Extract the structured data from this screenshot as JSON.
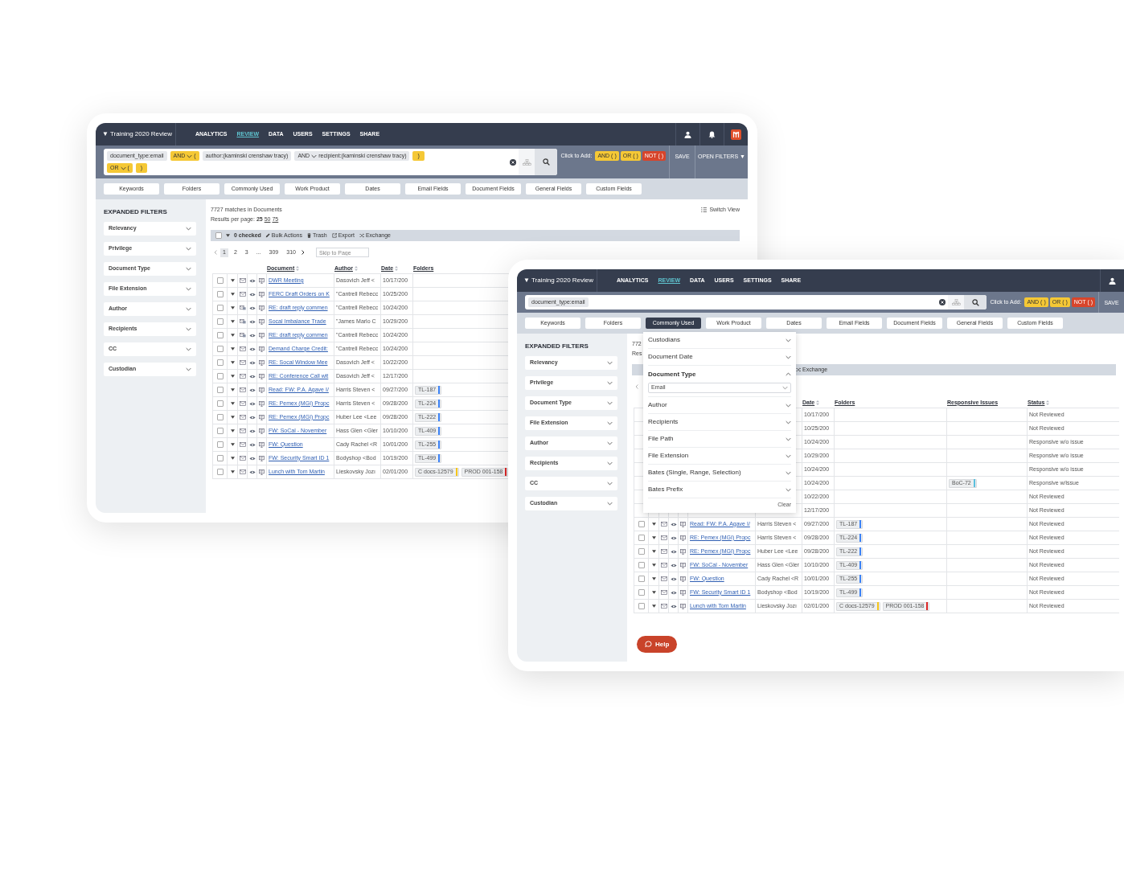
{
  "back_window": {
    "title": "▼ Training 2020 Review",
    "nav": [
      {
        "label": "ANALYTICS",
        "selected": false
      },
      {
        "label": "REVIEW",
        "selected": true
      },
      {
        "label": "DATA",
        "selected": false
      },
      {
        "label": "USERS",
        "selected": false
      },
      {
        "label": "SETTINGS",
        "selected": false
      },
      {
        "label": "SHARE",
        "selected": false
      }
    ],
    "header_buttons": [
      {
        "kind": "user"
      },
      {
        "kind": "bell"
      },
      {
        "kind": "logo"
      }
    ],
    "search": {
      "lines": [
        [
          {
            "kind": "term",
            "label": "document_type:email"
          },
          {
            "kind": "operator",
            "label": "AND",
            "suffix": "("
          },
          {
            "kind": "term",
            "label": "author:(kaminski crenshaw tracy)"
          },
          {
            "kind": "operator_term",
            "label": "AND",
            "suffix": "recipient:(kaminski crenshaw tracy)"
          },
          {
            "kind": "close",
            "label": ")"
          }
        ],
        [
          {
            "kind": "operator",
            "label": "OR",
            "suffix": "("
          },
          {
            "kind": "close",
            "label": ")"
          }
        ]
      ]
    },
    "click_to_add": {
      "label": "Click to Add:",
      "chips": [
        {
          "kind": "and",
          "label": "AND ( )"
        },
        {
          "kind": "or",
          "label": "OR ( )"
        },
        {
          "kind": "not",
          "label": "NOT ( )"
        }
      ]
    },
    "save": "SAVE",
    "open_filters": "OPEN FILTERS ▼",
    "filter_tabs": [
      {
        "label": "Keywords",
        "selected": false
      },
      {
        "label": "Folders",
        "selected": false
      },
      {
        "label": "Commonly Used",
        "selected": false
      },
      {
        "label": "Work Product",
        "selected": false
      },
      {
        "label": "Dates",
        "selected": false
      },
      {
        "label": "Email Fields",
        "selected": false
      },
      {
        "label": "Document Fields",
        "selected": false
      },
      {
        "label": "General Fields",
        "selected": false
      },
      {
        "label": "Custom Fields",
        "selected": false
      }
    ],
    "sidebar": {
      "heading": "EXPANDED FILTERS",
      "filters": [
        "Relevancy",
        "Privilege",
        "Document Type",
        "File Extension",
        "Author",
        "Recipients",
        "CC",
        "Custodian"
      ]
    },
    "results": {
      "matches": "7727 matches in Documents",
      "per_page_label": "Results per page:",
      "per_page": [
        {
          "label": "25",
          "selected": true
        },
        {
          "label": "50",
          "selected": false
        },
        {
          "label": "75",
          "selected": false
        }
      ]
    },
    "switch_view": "Switch View",
    "bulk": {
      "all_checked": false,
      "checked": "0 checked",
      "actions": [
        {
          "kind": "edit",
          "label": "Bulk Actions"
        },
        {
          "kind": "trash",
          "label": "Trash"
        },
        {
          "kind": "export",
          "label": "Export"
        },
        {
          "kind": "exchange",
          "label": "Exchange"
        }
      ]
    },
    "pagination": {
      "pages": [
        {
          "label": "1",
          "selected": true
        },
        {
          "label": "2",
          "selected": false
        },
        {
          "label": "3",
          "selected": false
        },
        {
          "label": "...",
          "selected": false
        },
        {
          "label": "309",
          "selected": false
        },
        {
          "label": "310",
          "selected": false
        }
      ],
      "skip_placeholder": "Skip to Page"
    },
    "table": {
      "columns": [
        {
          "kind": "document",
          "label": "Document",
          "sortable": true
        },
        {
          "kind": "author",
          "label": "Author",
          "sortable": true
        },
        {
          "kind": "date",
          "label": "Date",
          "sortable": true
        },
        {
          "kind": "folders",
          "label": "Folders",
          "sortable": false
        }
      ],
      "rows": [
        {
          "kind": "email",
          "checked": false,
          "document": "DWR Meeting",
          "author": "Dasovich Jeff <",
          "date": "10/17/200",
          "folders": []
        },
        {
          "kind": "email",
          "checked": false,
          "document": "FERC Draft Orders on K",
          "author": "\"Cantrell Rebecc",
          "date": "10/25/200",
          "folders": []
        },
        {
          "kind": "email_attachment",
          "checked": false,
          "document": "RE: draft reply commen",
          "author": "\"Cantrell Rebecc",
          "date": "10/24/200",
          "folders": []
        },
        {
          "kind": "email_attachment",
          "checked": false,
          "document": "Socal Imbalance Trade",
          "author": "\"James Marlo C",
          "date": "10/29/200",
          "folders": []
        },
        {
          "kind": "email_attachment",
          "checked": false,
          "document": "RE: draft reply commen",
          "author": "\"Cantrell Rebecc",
          "date": "10/24/200",
          "folders": []
        },
        {
          "kind": "email",
          "checked": false,
          "document": "Demand Charge Credit:",
          "author": "\"Cantrell Rebecc",
          "date": "10/24/200",
          "folders": []
        },
        {
          "kind": "email",
          "checked": false,
          "document": "RE: Socal Window Mee",
          "author": "Dasovich Jeff <",
          "date": "10/22/200",
          "folders": []
        },
        {
          "kind": "email",
          "checked": false,
          "document": "RE: Conference Call wit",
          "author": "Dasovich Jeff <",
          "date": "12/17/200",
          "folders": []
        },
        {
          "kind": "email",
          "checked": false,
          "document": "Read: FW: P.A. Agave I/",
          "author": "Harris Steven <",
          "date": "09/27/200",
          "folders": [
            {
              "label": "TL-187",
              "color": "#3b82f6"
            }
          ]
        },
        {
          "kind": "email",
          "checked": false,
          "document": "RE: Pemex (MGI) Propc",
          "author": "Harris Steven <",
          "date": "09/28/200",
          "folders": [
            {
              "label": "TL-224",
              "color": "#3b82f6"
            }
          ]
        },
        {
          "kind": "email",
          "checked": false,
          "document": "RE: Pemex (MGI) Propc",
          "author": "Huber Lee <Lee",
          "date": "09/28/200",
          "folders": [
            {
              "label": "TL-222",
              "color": "#3b82f6"
            }
          ]
        },
        {
          "kind": "email",
          "checked": false,
          "document": "FW: SoCal - November",
          "author": "Hass Glen <Gler",
          "date": "10/10/200",
          "folders": [
            {
              "label": "TL-409",
              "color": "#3b82f6"
            }
          ]
        },
        {
          "kind": "email",
          "checked": false,
          "document": "FW: Question",
          "author": "Cady Rachel <R",
          "date": "10/01/200",
          "folders": [
            {
              "label": "TL-255",
              "color": "#3b82f6"
            }
          ]
        },
        {
          "kind": "email",
          "checked": false,
          "document": "FW: Security Smart ID 1",
          "author": "Bodyshop <Bod",
          "date": "10/19/200",
          "folders": [
            {
              "label": "TL-499",
              "color": "#3b82f6"
            }
          ]
        },
        {
          "kind": "email",
          "checked": false,
          "document": "Lunch with Tom Martin",
          "author": "Lieskovsky Jozı",
          "date": "02/01/200",
          "folders": [
            {
              "label": "C docs-12579",
              "color": "#f5c518"
            },
            {
              "label": "PROD 001-158",
              "color": "#dc2626"
            }
          ]
        }
      ]
    }
  },
  "front_window": {
    "title": "▼ Training 2020 Review",
    "nav": [
      {
        "label": "ANALYTICS",
        "selected": false
      },
      {
        "label": "REVIEW",
        "selected": true
      },
      {
        "label": "DATA",
        "selected": false
      },
      {
        "label": "USERS",
        "selected": false
      },
      {
        "label": "SETTINGS",
        "selected": false
      },
      {
        "label": "SHARE",
        "selected": false
      }
    ],
    "header_buttons": [
      {
        "kind": "user"
      }
    ],
    "search": {
      "lines": [
        [
          {
            "kind": "term",
            "label": "document_type:email"
          }
        ]
      ]
    },
    "click_to_add": {
      "label": "Click to Add:",
      "chips": [
        {
          "kind": "and",
          "label": "AND ( )"
        },
        {
          "kind": "or",
          "label": "OR ( )"
        },
        {
          "kind": "not",
          "label": "NOT ( )"
        }
      ]
    },
    "save": "SAVE",
    "filter_tabs": [
      {
        "label": "Keywords",
        "selected": false
      },
      {
        "label": "Folders",
        "selected": false
      },
      {
        "label": "Commonly Used",
        "selected": true
      },
      {
        "label": "Work Product",
        "selected": false
      },
      {
        "label": "Dates",
        "selected": false
      },
      {
        "label": "Email Fields",
        "selected": false
      },
      {
        "label": "Document Fields",
        "selected": false
      },
      {
        "label": "General Fields",
        "selected": false
      },
      {
        "label": "Custom Fields",
        "selected": false
      }
    ],
    "sidebar": {
      "heading": "EXPANDED FILTERS",
      "filters": [
        "Relevancy",
        "Privilege",
        "Document Type",
        "File Extension",
        "Author",
        "Recipients",
        "CC",
        "Custodian"
      ]
    },
    "results": {
      "matches": "772",
      "per_page_label": "Res"
    },
    "bulk": {
      "actions": [
        {
          "kind": "exchange",
          "label": "Exchange"
        }
      ]
    },
    "table": {
      "columns": [
        {
          "kind": "date",
          "label": "Date",
          "sortable": true
        },
        {
          "kind": "folders",
          "label": "Folders",
          "sortable": false
        },
        {
          "kind": "issues",
          "label": "Responsive Issues",
          "sortable": false
        },
        {
          "kind": "status",
          "label": "Status",
          "sortable": true
        }
      ],
      "rows": [
        {
          "date": "10/17/200",
          "folders": [],
          "issues": [],
          "status": "Not Reviewed"
        },
        {
          "date": "10/25/200",
          "folders": [],
          "issues": [],
          "status": "Not Reviewed"
        },
        {
          "date": "10/24/200",
          "folders": [],
          "issues": [],
          "status": "Responsive w/o issue"
        },
        {
          "date": "10/29/200",
          "folders": [],
          "issues": [],
          "status": "Responsive w/o issue"
        },
        {
          "date": "10/24/200",
          "folders": [],
          "issues": [],
          "status": "Responsive w/o issue"
        },
        {
          "date": "10/24/200",
          "folders": [],
          "issues": [
            {
              "label": "BoC-72",
              "color": "#5bc0de"
            }
          ],
          "status": "Responsive w/issue"
        },
        {
          "date": "10/22/200",
          "folders": [],
          "issues": [],
          "status": "Not Reviewed"
        },
        {
          "date": "12/17/200",
          "folders": [],
          "issues": [],
          "status": "Not Reviewed"
        },
        {
          "kind": "email",
          "checked": false,
          "document": "Read: FW: P.A. Agave I/",
          "author": "Harris Steven <",
          "date": "09/27/200",
          "folders": [
            {
              "label": "TL-187",
              "color": "#3b82f6"
            }
          ],
          "issues": [],
          "status": "Not Reviewed"
        },
        {
          "kind": "email",
          "checked": false,
          "document": "RE: Pemex (MGI) Propc",
          "author": "Harris Steven <",
          "date": "09/28/200",
          "folders": [
            {
              "label": "TL-224",
              "color": "#3b82f6"
            }
          ],
          "issues": [],
          "status": "Not Reviewed"
        },
        {
          "kind": "email",
          "checked": false,
          "document": "RE: Pemex (MGI) Propc",
          "author": "Huber Lee <Lee",
          "date": "09/28/200",
          "folders": [
            {
              "label": "TL-222",
              "color": "#3b82f6"
            }
          ],
          "issues": [],
          "status": "Not Reviewed"
        },
        {
          "kind": "email",
          "checked": false,
          "document": "FW: SoCal - November",
          "author": "Hass Glen <Gler",
          "date": "10/10/200",
          "folders": [
            {
              "label": "TL-409",
              "color": "#3b82f6"
            }
          ],
          "issues": [],
          "status": "Not Reviewed"
        },
        {
          "kind": "email",
          "checked": false,
          "document": "FW: Question",
          "author": "Cady Rachel <R",
          "date": "10/01/200",
          "folders": [
            {
              "label": "TL-255",
              "color": "#3b82f6"
            }
          ],
          "issues": [],
          "status": "Not Reviewed"
        },
        {
          "kind": "email",
          "checked": false,
          "document": "FW: Security Smart ID 1",
          "author": "Bodyshop <Bod",
          "date": "10/19/200",
          "folders": [
            {
              "label": "TL-499",
              "color": "#3b82f6"
            }
          ],
          "issues": [],
          "status": "Not Reviewed"
        },
        {
          "kind": "email",
          "checked": false,
          "document": "Lunch with Tom Martin",
          "author": "Lieskovsky Jozı",
          "date": "02/01/200",
          "folders": [
            {
              "label": "C docs-12579",
              "color": "#f5c518"
            },
            {
              "label": "PROD 001-158",
              "color": "#dc2626"
            }
          ],
          "issues": [],
          "status": "Not Reviewed"
        }
      ]
    },
    "dropdown": {
      "items": [
        {
          "label": "Custodians",
          "expanded": false
        },
        {
          "label": "Document Date",
          "expanded": false
        },
        {
          "label": "Document Type",
          "expanded": true,
          "value": "Email"
        },
        {
          "label": "Author",
          "expanded": false
        },
        {
          "label": "Recipients",
          "expanded": false
        },
        {
          "label": "File Path",
          "expanded": false
        },
        {
          "label": "File Extension",
          "expanded": false
        },
        {
          "label": "Bates (Single, Range, Selection)",
          "expanded": false
        },
        {
          "label": "Bates Prefix",
          "expanded": false
        }
      ],
      "clear": "Clear"
    },
    "help": "Help"
  }
}
